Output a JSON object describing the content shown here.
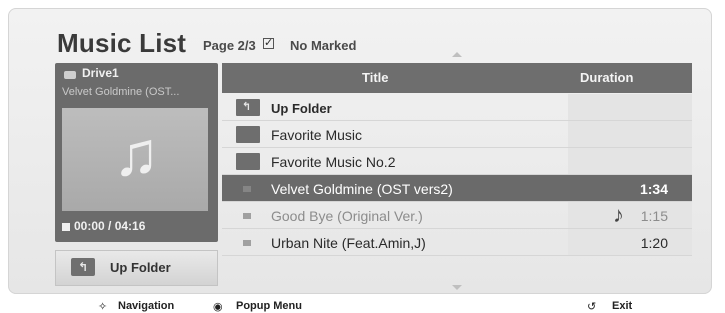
{
  "header": {
    "title": "Music List",
    "page": "Page 2/3",
    "mark_status": "No Marked"
  },
  "left_panel": {
    "drive_label": "Drive1",
    "track_name": "Velvet Goldmine (OST...",
    "time": "00:00 / 04:16",
    "up_folder_button": "Up Folder"
  },
  "table": {
    "columns": [
      "Title",
      "Duration"
    ],
    "rows": [
      {
        "type": "up-folder",
        "title": "Up Folder",
        "duration": ""
      },
      {
        "type": "folder",
        "title": "Favorite Music",
        "duration": ""
      },
      {
        "type": "folder",
        "title": "Favorite Music No.2",
        "duration": ""
      },
      {
        "type": "music",
        "title": "Velvet Goldmine (OST vers2)",
        "duration": "1:34",
        "selected": true
      },
      {
        "type": "music",
        "title": "Good Bye (Original Ver.)",
        "duration": "1:15",
        "playing": true
      },
      {
        "type": "music",
        "title": "Urban Nite (Feat.Amin,J)",
        "duration": "1:20"
      }
    ]
  },
  "footer": {
    "navigation": "Navigation",
    "popup_menu": "Popup Menu",
    "exit": "Exit"
  },
  "colors": {
    "header_bg": "#6e6e6e",
    "selected_row": "#6a6a6a",
    "panel_bg": "#6b6b6b"
  }
}
